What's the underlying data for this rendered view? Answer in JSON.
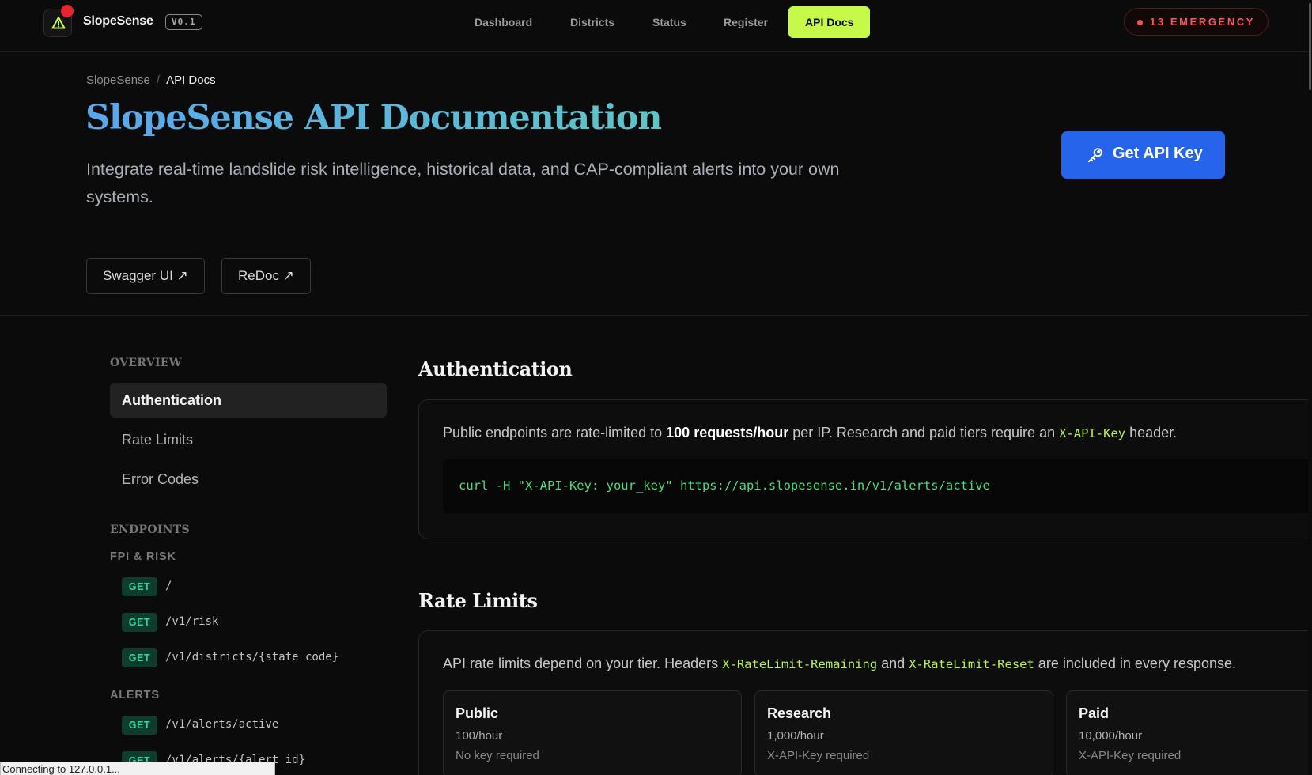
{
  "nav": {
    "brand": "SlopeSense",
    "version": "V0.1",
    "links": [
      "Dashboard",
      "Districts",
      "Status",
      "Register",
      "API Docs"
    ],
    "emergency": "13 EMERGENCY",
    "colors": {
      "accent": "#c6f94a",
      "emergency": "#ff5560"
    }
  },
  "hero": {
    "breadcrumb": [
      "SlopeSense",
      "API Docs"
    ],
    "title": "SlopeSense API Documentation",
    "subtitle": "Integrate real-time landslide risk intelligence, historical data, and CAP-compliant alerts into your own systems.",
    "api_key_button": "Get API Key",
    "buttons": [
      "Swagger UI ↗",
      "ReDoc ↗"
    ]
  },
  "sidebar": {
    "overview_heading": "OVERVIEW",
    "overview_items": [
      "Authentication",
      "Rate Limits",
      "Error Codes"
    ],
    "endpoints_heading": "ENDPOINTS",
    "groups": [
      {
        "name": "FPI & RISK",
        "endpoints": [
          {
            "method": "GET",
            "path": "/"
          },
          {
            "method": "GET",
            "path": "/v1/risk"
          },
          {
            "method": "GET",
            "path": "/v1/districts/{state_code}"
          }
        ]
      },
      {
        "name": "ALERTS",
        "endpoints": [
          {
            "method": "GET",
            "path": "/v1/alerts/active"
          },
          {
            "method": "GET",
            "path": "/v1/alerts/{alert_id}"
          }
        ]
      }
    ]
  },
  "auth": {
    "heading": "Authentication",
    "text_1": "Public endpoints are rate-limited to ",
    "text_bold": "100 requests/hour",
    "text_2": " per IP. Research and paid tiers require an ",
    "text_code": "X-API-Key",
    "text_3": " header.",
    "curl": "curl -H \"X-API-Key: your_key\" https://api.slopesense.in/v1/alerts/active"
  },
  "rate_limits": {
    "heading": "Rate Limits",
    "text_1": "API rate limits depend on your tier. Headers ",
    "code_1": "X-RateLimit-Remaining",
    "text_2": " and ",
    "code_2": "X-RateLimit-Reset",
    "text_3": " are included in every response.",
    "tiers": [
      {
        "name": "Public",
        "rate": "100/hour",
        "key": "No key required"
      },
      {
        "name": "Research",
        "rate": "1,000/hour",
        "key": "X-API-Key required"
      },
      {
        "name": "Paid",
        "rate": "10,000/hour",
        "key": "X-API-Key required"
      }
    ]
  },
  "status_bar": "Connecting to 127.0.0.1..."
}
